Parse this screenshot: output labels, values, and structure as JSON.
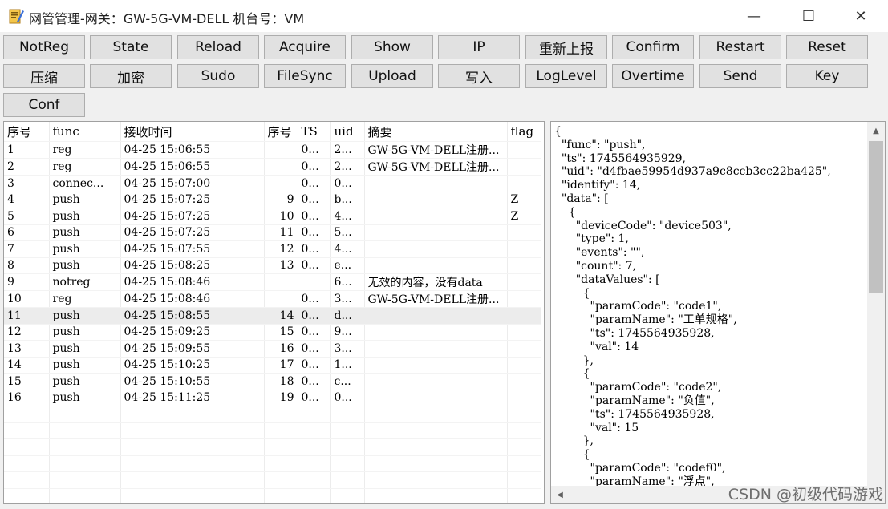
{
  "window": {
    "title": "网管管理-网关：GW-5G-VM-DELL 机台号：VM",
    "controls": {
      "minimize": "—",
      "maximize": "☐",
      "close": "✕"
    }
  },
  "toolbar": {
    "buttons": [
      "NotReg",
      "State",
      "Reload",
      "Acquire",
      "Show",
      "IP",
      "重新上报",
      "Confirm",
      "Restart",
      "Reset",
      "压缩",
      "加密",
      "Sudo",
      "FileSync",
      "Upload",
      "写入",
      "LogLevel",
      "Overtime",
      "Send",
      "Key",
      "Conf"
    ]
  },
  "table": {
    "columns": [
      "序号",
      "func",
      "接收时间",
      "序号",
      "TS",
      "uid",
      "摘要",
      "flag"
    ],
    "rows": [
      [
        "1",
        "reg",
        "04-25 15:06:55",
        "",
        "0...",
        "2...",
        "GW-5G-VM-DELL注册...",
        ""
      ],
      [
        "2",
        "reg",
        "04-25 15:06:55",
        "",
        "0...",
        "2...",
        "GW-5G-VM-DELL注册...",
        ""
      ],
      [
        "3",
        "connec...",
        "04-25 15:07:00",
        "",
        "0...",
        "0...",
        "",
        ""
      ],
      [
        "4",
        "push",
        "04-25 15:07:25",
        "9",
        "0...",
        "b...",
        "",
        "Z"
      ],
      [
        "5",
        "push",
        "04-25 15:07:25",
        "10",
        "0...",
        "4...",
        "",
        "Z"
      ],
      [
        "6",
        "push",
        "04-25 15:07:25",
        "11",
        "0...",
        "5...",
        "",
        ""
      ],
      [
        "7",
        "push",
        "04-25 15:07:55",
        "12",
        "0...",
        "4...",
        "",
        ""
      ],
      [
        "8",
        "push",
        "04-25 15:08:25",
        "13",
        "0...",
        "e...",
        "",
        ""
      ],
      [
        "9",
        "notreg",
        "04-25 15:08:46",
        "",
        "",
        "6...",
        "无效的内容，没有data",
        ""
      ],
      [
        "10",
        "reg",
        "04-25 15:08:46",
        "",
        "0...",
        "3...",
        "GW-5G-VM-DELL注册...",
        ""
      ],
      [
        "11",
        "push",
        "04-25 15:08:55",
        "14",
        "0...",
        "d...",
        "",
        ""
      ],
      [
        "12",
        "push",
        "04-25 15:09:25",
        "15",
        "0...",
        "9...",
        "",
        ""
      ],
      [
        "13",
        "push",
        "04-25 15:09:55",
        "16",
        "0...",
        "3...",
        "",
        ""
      ],
      [
        "14",
        "push",
        "04-25 15:10:25",
        "17",
        "0...",
        "1...",
        "",
        ""
      ],
      [
        "15",
        "push",
        "04-25 15:10:55",
        "18",
        "0...",
        "c...",
        "",
        ""
      ],
      [
        "16",
        "push",
        "04-25 15:11:25",
        "19",
        "0...",
        "0...",
        "",
        ""
      ]
    ],
    "selected_row": 10
  },
  "json_view": {
    "text": "{\n  \"func\": \"push\",\n  \"ts\": 1745564935929,\n  \"uid\": \"d4fbae59954d937a9c8ccb3cc22ba425\",\n  \"identify\": 14,\n  \"data\": [\n    {\n      \"deviceCode\": \"device503\",\n      \"type\": 1,\n      \"events\": \"\",\n      \"count\": 7,\n      \"dataValues\": [\n        {\n          \"paramCode\": \"code1\",\n          \"paramName\": \"工单规格\",\n          \"ts\": 1745564935928,\n          \"val\": 14\n        },\n        {\n          \"paramCode\": \"code2\",\n          \"paramName\": \"负值\",\n          \"ts\": 1745564935928,\n          \"val\": 15\n        },\n        {\n          \"paramCode\": \"codef0\",\n          \"paramName\": \"浮点\","
  },
  "watermark": "CSDN @初级代码游戏"
}
